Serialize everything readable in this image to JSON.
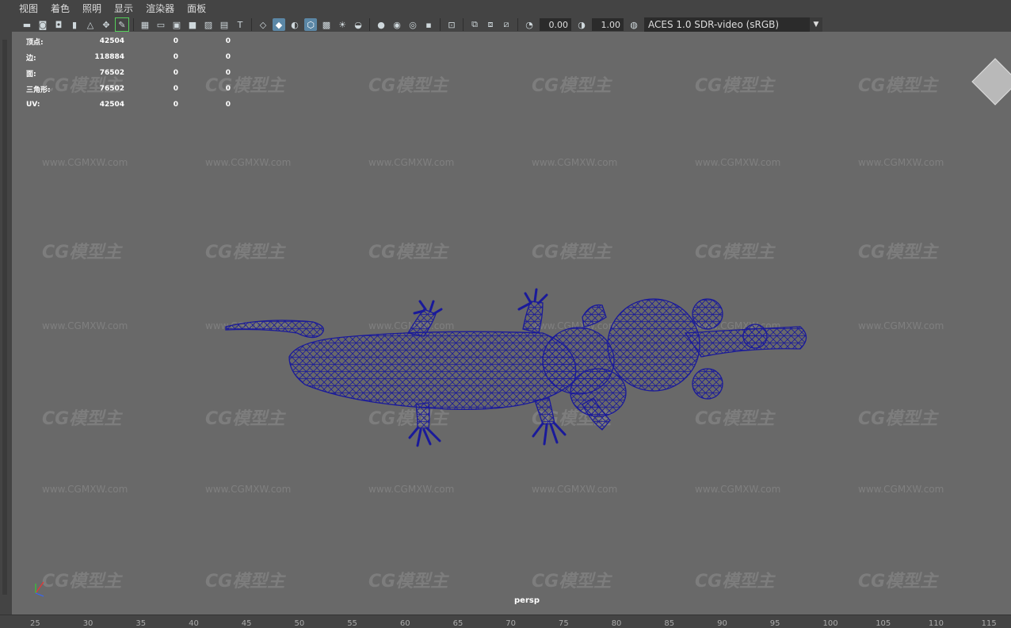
{
  "menu": [
    "视图",
    "着色",
    "照明",
    "显示",
    "渲染器",
    "面板"
  ],
  "toolbar": {
    "exposure": "0.00",
    "gamma": "1.00",
    "color_space": "ACES 1.0 SDR-video (sRGB)"
  },
  "hud": {
    "rows": [
      {
        "label": "顶点:",
        "v1": "42504",
        "v2": "0",
        "v3": "0"
      },
      {
        "label": "边:",
        "v1": "118884",
        "v2": "0",
        "v3": "0"
      },
      {
        "label": "面:",
        "v1": "76502",
        "v2": "0",
        "v3": "0"
      },
      {
        "label": "三角形:",
        "v1": "76502",
        "v2": "0",
        "v3": "0"
      },
      {
        "label": "UV:",
        "v1": "42504",
        "v2": "0",
        "v3": "0"
      }
    ]
  },
  "watermark": {
    "logo": "CG模型主",
    "url": "www.CGMXW.com"
  },
  "viewport": {
    "camera": "persp"
  },
  "ruler": [
    "25",
    "30",
    "35",
    "40",
    "45",
    "50",
    "55",
    "60",
    "65",
    "70",
    "75",
    "80",
    "85",
    "90",
    "95",
    "100",
    "105",
    "110",
    "115"
  ],
  "colors": {
    "wireframe": "#1a1a9a",
    "viewport_bg": "#696969",
    "ui_bg": "#444444",
    "accent": "#5b87a6"
  }
}
